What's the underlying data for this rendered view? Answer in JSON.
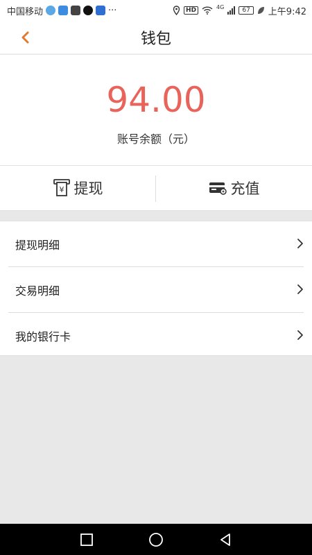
{
  "status_bar": {
    "carrier": "中国移动",
    "more": "···",
    "hd": "HD",
    "network": "4G",
    "battery": "67",
    "time": "上午9:42"
  },
  "header": {
    "title": "钱包",
    "back_icon": "chevron-left-icon"
  },
  "balance": {
    "amount": "94.00",
    "label": "账号余额（元）"
  },
  "actions": [
    {
      "label": "提现",
      "icon": "atm-withdraw-icon"
    },
    {
      "label": "充值",
      "icon": "credit-card-icon"
    }
  ],
  "menu": {
    "items": [
      {
        "label": "提现明细"
      },
      {
        "label": "交易明细"
      },
      {
        "label": "我的银行卡"
      }
    ]
  },
  "colors": {
    "accent": "#e8645a",
    "back": "#e07a2f"
  }
}
